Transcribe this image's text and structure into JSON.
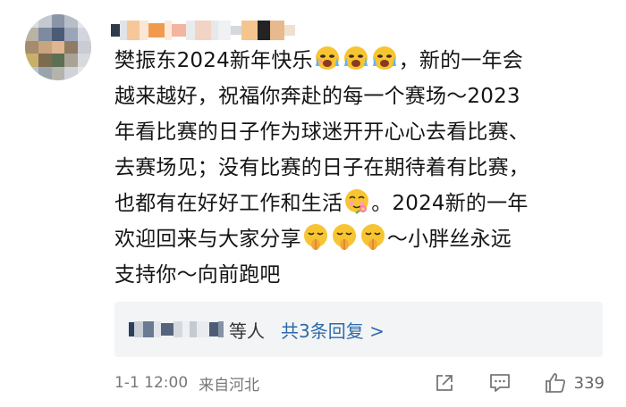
{
  "comment": {
    "lines": [
      [
        "樊振东2024新年快乐",
        "EMOJI3_CRY",
        "，新的一年会"
      ],
      [
        "越来越好，祝福你奔赴的每一个赛场～2023"
      ],
      [
        "年看比赛的日子作为球迷开开心心去看比赛、"
      ],
      [
        "去赛场见；没有比赛的日子在期待着有比赛，"
      ],
      [
        "也都有在好好工作和生活",
        "EMOJI1_FLOWER",
        "。2024新的一年"
      ],
      [
        "欢迎回来与大家分享",
        "EMOJI3_BLESS",
        "～小胖丝永远"
      ],
      [
        "支持你～向前跑吧"
      ]
    ],
    "l1_a": "樊振东2024新年快乐",
    "l1_b": "，新的一年会",
    "l2": "越来越好，祝福你奔赴的每一个赛场～2023",
    "l3": "年看比赛的日子作为球迷开开心心去看比赛、",
    "l4": "去赛场见；没有比赛的日子在期待着有比赛，",
    "l5_a": "也都有在好好工作和生活",
    "l5_b": "。2024新的一年",
    "l6_a": "欢迎回来与大家分享",
    "l6_b": "～小胖丝永远",
    "l7": "支持你～向前跑吧"
  },
  "emoji_icons": {
    "cry": "crying-face-icon",
    "flower": "face-with-flower-icon",
    "bless": "praying-face-icon"
  },
  "replies": {
    "who": "等人",
    "count": "共3条回复 >"
  },
  "footer": {
    "time": "1-1 12:00",
    "location": "来自河北",
    "like_count": "339"
  },
  "colors": {
    "link": "#2d6aa8",
    "reply_bg": "#f3f4f6",
    "meta": "#777777"
  }
}
